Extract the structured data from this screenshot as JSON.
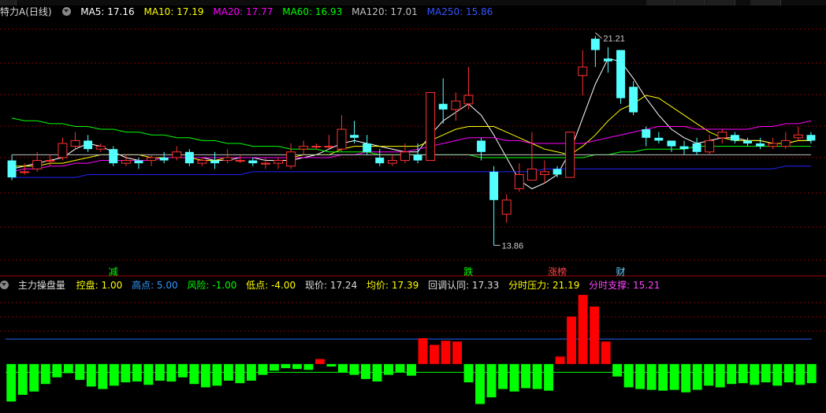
{
  "main_header": {
    "title": "特力A(日线)",
    "items": [
      {
        "label": "MA5: 17.16",
        "color": "#ffffff"
      },
      {
        "label": "MA10: 17.19",
        "color": "#ffff00"
      },
      {
        "label": "MA20: 17.77",
        "color": "#ff00ff"
      },
      {
        "label": "MA60: 16.93",
        "color": "#00ff00"
      },
      {
        "label": "MA120: 17.01",
        "color": "#c0c0c0"
      },
      {
        "label": "MA250: 15.86",
        "color": "#3355ff"
      }
    ]
  },
  "sub_header": {
    "title": "主力操盘量",
    "items": [
      {
        "label": "控盘: 1.00",
        "color": "#ffff00"
      },
      {
        "label": "高点: 5.00",
        "color": "#3399ff"
      },
      {
        "label": "风险: -1.00",
        "color": "#00ff00"
      },
      {
        "label": "低点: -4.00",
        "color": "#ffff00"
      },
      {
        "label": "现价: 17.24",
        "color": "#dddddd"
      },
      {
        "label": "均价: 17.39",
        "color": "#ffff00"
      },
      {
        "label": "回调认同: 17.33",
        "color": "#dddddd"
      },
      {
        "label": "分时压力: 21.19",
        "color": "#ffff00"
      },
      {
        "label": "分时支撑: 15.21",
        "color": "#ff44ff"
      }
    ]
  },
  "colors": {
    "up": "#ff3232",
    "down": "#54ffff",
    "grid": "#800000",
    "ma250": "#2222ff",
    "bar_pos": "#ff0000",
    "bar_neg": "#00ff00",
    "line_high": "#2266ff"
  },
  "annotations": {
    "high_label": "21.21",
    "low_label": "13.86"
  },
  "markers": [
    {
      "text": "减",
      "index": 8,
      "color": "#00ff00"
    },
    {
      "text": "跌",
      "index": 36,
      "color": "#00ff00"
    },
    {
      "text": "涨榜",
      "index": 43,
      "color": "#ff4444"
    },
    {
      "text": "财",
      "index": 48,
      "color": "#66ccff"
    }
  ],
  "chart_data": [
    {
      "type": "candlestick",
      "ylim": [
        13.2,
        22.0
      ],
      "candles": [
        [
          17.0,
          16.4,
          17.2,
          16.3
        ],
        [
          16.6,
          16.6,
          16.9,
          16.5
        ],
        [
          16.7,
          17.0,
          17.3,
          16.6
        ],
        [
          17.0,
          17.0,
          17.2,
          16.8
        ],
        [
          17.1,
          17.6,
          17.8,
          17.0
        ],
        [
          17.5,
          17.7,
          18.0,
          17.4
        ],
        [
          17.7,
          17.4,
          17.9,
          17.3
        ],
        [
          17.4,
          17.5,
          17.6,
          17.3
        ],
        [
          17.4,
          16.9,
          17.5,
          16.8
        ],
        [
          16.9,
          17.0,
          17.2,
          16.8
        ],
        [
          17.0,
          16.9,
          17.1,
          16.7
        ],
        [
          17.0,
          17.1,
          17.2,
          16.8
        ],
        [
          17.1,
          17.0,
          17.3,
          16.9
        ],
        [
          17.1,
          17.3,
          17.5,
          17.0
        ],
        [
          17.3,
          16.9,
          17.4,
          16.8
        ],
        [
          16.9,
          17.0,
          17.1,
          16.8
        ],
        [
          17.0,
          16.9,
          17.3,
          16.7
        ],
        [
          17.0,
          17.1,
          17.4,
          16.9
        ],
        [
          17.0,
          17.0,
          17.2,
          16.9
        ],
        [
          17.0,
          16.9,
          17.1,
          16.8
        ],
        [
          16.9,
          16.9,
          17.1,
          16.7
        ],
        [
          16.9,
          17.0,
          17.1,
          16.7
        ],
        [
          16.8,
          17.3,
          17.6,
          16.7
        ],
        [
          17.4,
          17.5,
          17.7,
          17.2
        ],
        [
          17.5,
          17.5,
          17.6,
          17.4
        ],
        [
          17.5,
          17.5,
          17.9,
          17.4
        ],
        [
          17.4,
          18.1,
          18.6,
          17.3
        ],
        [
          17.9,
          17.8,
          18.4,
          17.6
        ],
        [
          17.6,
          17.3,
          17.9,
          17.2
        ],
        [
          17.1,
          16.9,
          17.4,
          16.8
        ],
        [
          16.9,
          17.0,
          17.2,
          16.8
        ],
        [
          17.0,
          17.3,
          17.6,
          16.9
        ],
        [
          17.2,
          17.0,
          17.6,
          16.9
        ],
        [
          17.0,
          19.4,
          19.4,
          17.0
        ],
        [
          19.0,
          18.8,
          19.9,
          18.3
        ],
        [
          18.8,
          19.1,
          19.4,
          18.4
        ],
        [
          19.0,
          19.3,
          20.3,
          18.8
        ],
        [
          17.7,
          17.3,
          17.8,
          17.0
        ],
        [
          16.6,
          15.6,
          16.8,
          14.0
        ],
        [
          15.1,
          15.6,
          15.8,
          14.8
        ],
        [
          16.0,
          16.5,
          16.9,
          15.9
        ],
        [
          16.3,
          16.7,
          18.0,
          16.3
        ],
        [
          16.5,
          16.6,
          17.0,
          16.2
        ],
        [
          16.7,
          16.5,
          16.8,
          16.4
        ],
        [
          16.4,
          18.0,
          18.0,
          16.4
        ],
        [
          20.0,
          20.3,
          20.9,
          19.3
        ],
        [
          21.3,
          20.9,
          21.4,
          20.3
        ],
        [
          20.6,
          20.5,
          21.0,
          20.1
        ],
        [
          20.9,
          19.2,
          20.9,
          19.0
        ],
        [
          19.6,
          18.7,
          19.8,
          18.6
        ],
        [
          18.1,
          17.8,
          18.2,
          17.5
        ],
        [
          17.8,
          17.7,
          18.0,
          17.6
        ],
        [
          17.7,
          17.5,
          17.7,
          17.3
        ],
        [
          17.5,
          17.4,
          17.7,
          17.2
        ],
        [
          17.6,
          17.3,
          17.8,
          17.2
        ],
        [
          17.3,
          17.7,
          17.9,
          17.2
        ],
        [
          17.8,
          18.0,
          18.1,
          17.6
        ],
        [
          17.9,
          17.7,
          18.0,
          17.6
        ],
        [
          17.7,
          17.6,
          17.8,
          17.5
        ],
        [
          17.6,
          17.5,
          17.8,
          17.4
        ],
        [
          17.5,
          17.6,
          17.8,
          17.4
        ],
        [
          17.5,
          17.7,
          18.0,
          17.4
        ],
        [
          17.8,
          17.9,
          18.2,
          17.7
        ],
        [
          17.9,
          17.7,
          18.0,
          17.6
        ]
      ],
      "series": [
        {
          "name": "MA5",
          "color": "#ffffff",
          "values": [
            16.7,
            16.8,
            16.9,
            17.0,
            17.1,
            17.4,
            17.6,
            17.5,
            17.3,
            17.1,
            17.0,
            17.0,
            17.1,
            17.1,
            17.1,
            17.1,
            17.0,
            17.0,
            17.1,
            17.1,
            17.0,
            17.0,
            17.0,
            17.1,
            17.2,
            17.4,
            17.6,
            17.7,
            17.6,
            17.5,
            17.4,
            17.3,
            17.3,
            17.9,
            18.4,
            18.7,
            19.0,
            18.6,
            17.9,
            17.1,
            16.3,
            16.0,
            16.2,
            16.5,
            17.3,
            18.5,
            19.7,
            20.6,
            20.5,
            19.9,
            19.2,
            18.6,
            18.1,
            17.8,
            17.6,
            17.7,
            17.8,
            17.8,
            17.7,
            17.7,
            17.6,
            17.6,
            17.7,
            17.7
          ]
        },
        {
          "name": "MA10",
          "color": "#ffff00",
          "values": [
            16.8,
            16.8,
            16.8,
            16.9,
            16.9,
            17.0,
            17.1,
            17.2,
            17.2,
            17.2,
            17.2,
            17.1,
            17.1,
            17.1,
            17.1,
            17.0,
            17.0,
            17.1,
            17.1,
            17.1,
            17.1,
            17.1,
            17.1,
            17.2,
            17.2,
            17.2,
            17.4,
            17.5,
            17.5,
            17.5,
            17.5,
            17.5,
            17.5,
            17.7,
            17.9,
            18.1,
            18.2,
            18.2,
            18.2,
            18.0,
            17.8,
            17.6,
            17.4,
            17.3,
            17.2,
            17.5,
            17.9,
            18.4,
            18.8,
            19.0,
            19.3,
            19.2,
            18.9,
            18.6,
            18.3,
            18.0,
            17.8,
            17.7,
            17.7,
            17.7,
            17.6,
            17.6,
            17.7,
            17.7
          ]
        },
        {
          "name": "MA20",
          "color": "#ff00ff",
          "values": [
            16.6,
            16.7,
            16.7,
            16.8,
            16.8,
            16.9,
            16.9,
            17.0,
            17.0,
            17.0,
            17.0,
            17.0,
            17.1,
            17.1,
            17.1,
            17.1,
            17.1,
            17.1,
            17.1,
            17.1,
            17.1,
            17.1,
            17.1,
            17.1,
            17.1,
            17.1,
            17.2,
            17.2,
            17.3,
            17.3,
            17.3,
            17.3,
            17.4,
            17.5,
            17.6,
            17.7,
            17.8,
            17.8,
            17.8,
            17.7,
            17.7,
            17.6,
            17.6,
            17.6,
            17.6,
            17.6,
            17.7,
            17.8,
            17.9,
            18.0,
            18.1,
            18.2,
            18.2,
            18.2,
            18.1,
            18.1,
            18.1,
            18.1,
            18.1,
            18.2,
            18.2,
            18.3,
            18.3,
            18.4
          ]
        },
        {
          "name": "MA60",
          "color": "#00ff00",
          "values": [
            18.5,
            18.4,
            18.4,
            18.3,
            18.3,
            18.2,
            18.2,
            18.1,
            18.1,
            18.0,
            18.0,
            17.9,
            17.9,
            17.8,
            17.8,
            17.7,
            17.7,
            17.6,
            17.6,
            17.5,
            17.5,
            17.5,
            17.4,
            17.4,
            17.4,
            17.3,
            17.3,
            17.3,
            17.3,
            17.2,
            17.2,
            17.2,
            17.2,
            17.2,
            17.2,
            17.2,
            17.2,
            17.1,
            17.1,
            17.1,
            17.1,
            17.1,
            17.1,
            17.1,
            17.1,
            17.1,
            17.2,
            17.2,
            17.3,
            17.3,
            17.4,
            17.4,
            17.4,
            17.4,
            17.5,
            17.5,
            17.5,
            17.5,
            17.5,
            17.5,
            17.5,
            17.5,
            17.5,
            17.5
          ]
        },
        {
          "name": "MA120",
          "color": "#c0c0c0",
          "values": [
            17.2,
            17.2,
            17.2,
            17.2,
            17.2,
            17.2,
            17.2,
            17.2,
            17.2,
            17.2,
            17.2,
            17.2,
            17.2,
            17.2,
            17.2,
            17.2,
            17.2,
            17.2,
            17.2,
            17.2,
            17.2,
            17.2,
            17.2,
            17.2,
            17.2,
            17.2,
            17.2,
            17.2,
            17.2,
            17.2,
            17.2,
            17.2,
            17.2,
            17.2,
            17.2,
            17.2,
            17.2,
            17.2,
            17.2,
            17.2,
            17.2,
            17.2,
            17.2,
            17.2,
            17.2,
            17.2,
            17.2,
            17.2,
            17.2,
            17.2,
            17.2,
            17.2,
            17.2,
            17.2,
            17.2,
            17.2,
            17.2,
            17.2,
            17.2,
            17.2,
            17.2,
            17.2,
            17.2,
            17.2
          ]
        },
        {
          "name": "MA250",
          "color": "#2222ff",
          "values": [
            16.4,
            16.4,
            16.4,
            16.4,
            16.4,
            16.4,
            16.5,
            16.5,
            16.5,
            16.5,
            16.5,
            16.5,
            16.5,
            16.5,
            16.5,
            16.5,
            16.5,
            16.5,
            16.5,
            16.6,
            16.6,
            16.6,
            16.6,
            16.6,
            16.6,
            16.6,
            16.6,
            16.6,
            16.6,
            16.6,
            16.6,
            16.6,
            16.6,
            16.6,
            16.6,
            16.6,
            16.6,
            16.6,
            16.6,
            16.6,
            16.6,
            16.6,
            16.7,
            16.7,
            16.7,
            16.7,
            16.7,
            16.7,
            16.7,
            16.7,
            16.7,
            16.7,
            16.7,
            16.7,
            16.7,
            16.7,
            16.7,
            16.7,
            16.7,
            16.7,
            16.7,
            16.8,
            16.8,
            16.8
          ]
        }
      ]
    },
    {
      "type": "bar",
      "ylim": [
        -5.5,
        8.5
      ],
      "values": [
        -4.5,
        -3.7,
        -3.3,
        -2.4,
        -1.6,
        -1.1,
        -1.9,
        -2.7,
        -3.0,
        -2.6,
        -2.2,
        -2.1,
        -2.5,
        -2.0,
        -2.1,
        -1.6,
        -2.4,
        -2.8,
        -2.6,
        -2.0,
        -2.3,
        -2.0,
        -1.3,
        -0.8,
        -0.5,
        -0.6,
        -0.7,
        0.6,
        -0.3,
        -1.0,
        -1.3,
        -1.8,
        -2.1,
        -1.3,
        -1.0,
        -1.4,
        3.1,
        2.3,
        2.8,
        2.7,
        -2.2,
        -4.8,
        -4.0,
        -3.0,
        -3.3,
        -2.9,
        -3.0,
        -3.2,
        0.9,
        5.7,
        8.3,
        6.9,
        2.7,
        -1.5,
        -2.8,
        -3.0,
        -3.1,
        -3.2,
        -3.1,
        -3.4,
        -3.1,
        -2.6,
        -2.8,
        -2.4,
        -2.3,
        -2.5,
        -2.2,
        -2.6,
        -2.2,
        -2.5,
        -2.3
      ],
      "reference_lines": [
        {
          "value": 3.0,
          "color": "#2266ff"
        },
        {
          "value": -1.0,
          "color": "#00ff00"
        }
      ]
    }
  ]
}
